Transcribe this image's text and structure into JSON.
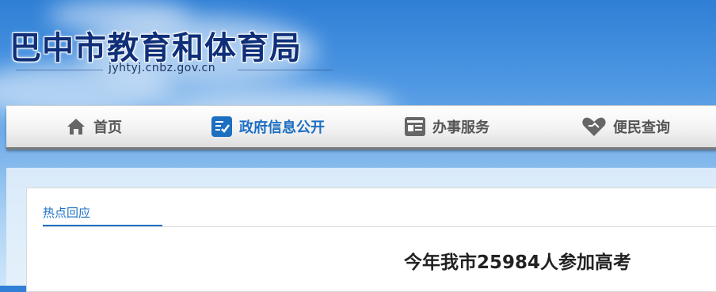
{
  "header": {
    "site_title": "巴中市教育和体育局",
    "domain": "jyhtyj.cnbz.gov.cn"
  },
  "nav": {
    "items": [
      {
        "label": "首页",
        "icon": "home-icon"
      },
      {
        "label": "政府信息公开",
        "icon": "document-check-icon",
        "active": true
      },
      {
        "label": "办事服务",
        "icon": "service-card-icon"
      },
      {
        "label": "便民查询",
        "icon": "heart-handshake-icon"
      }
    ],
    "active_color": "#1d6fc2"
  },
  "content": {
    "breadcrumb": "热点回应",
    "article_title": "今年我市25984人参加高考"
  }
}
